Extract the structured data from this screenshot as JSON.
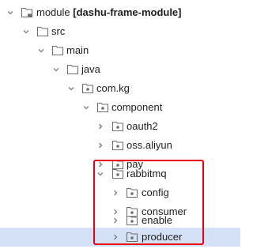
{
  "tree": {
    "module": {
      "name": "module",
      "qualifier": "[dashu-frame-module]"
    },
    "src": "src",
    "main": "main",
    "java": "java",
    "com_kg": "com.kg",
    "component": "component",
    "oauth2": "oauth2",
    "oss_aliyun": "oss.aliyun",
    "pay": "pay",
    "rabbitmq": "rabbitmq",
    "config": "config",
    "consumer": "consumer",
    "enable": "enable",
    "producer": "producer"
  },
  "colors": {
    "folder_outline": "#6e6e6e",
    "package_dot": "#6e6e6e",
    "chevron": "#6e6e6e",
    "selection": "#d5e1f7",
    "highlight_border": "#e60012"
  }
}
